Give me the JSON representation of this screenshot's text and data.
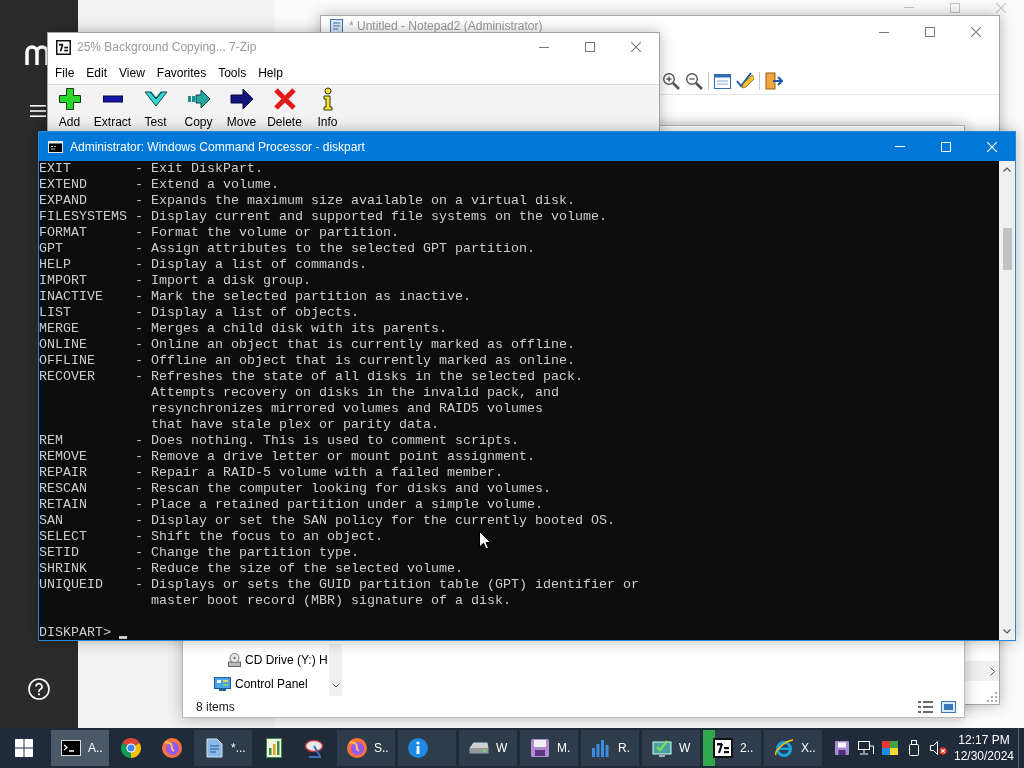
{
  "notepad_window": {
    "title": "* Untitled - Notepad2 (Administrator)"
  },
  "explorer_window": {
    "tree": [
      {
        "children": [
          {
            "label": "CD Drive (Y:) H",
            "kind": "cd-drive"
          }
        ]
      },
      {
        "label": "Control Panel",
        "kind": "control-panel"
      }
    ],
    "status_bar": "8 items"
  },
  "zip_window": {
    "title": "25% Background Copying... 7-Zip",
    "menu": [
      "File",
      "Edit",
      "View",
      "Favorites",
      "Tools",
      "Help"
    ],
    "toolbar": [
      {
        "label": "Add",
        "kind": "add"
      },
      {
        "label": "Extract",
        "kind": "extract"
      },
      {
        "label": "Test",
        "kind": "test"
      },
      {
        "label": "Copy",
        "kind": "copy"
      },
      {
        "label": "Move",
        "kind": "move"
      },
      {
        "label": "Delete",
        "kind": "delete"
      },
      {
        "label": "Info",
        "kind": "info"
      }
    ]
  },
  "console_window": {
    "title": "Administrator: Windows Command Processor - diskpart",
    "entries": [
      {
        "command": "EXIT",
        "lines": [
          "- Exit DiskPart."
        ]
      },
      {
        "command": "EXTEND",
        "lines": [
          "- Extend a volume."
        ]
      },
      {
        "command": "EXPAND",
        "lines": [
          "- Expands the maximum size available on a virtual disk."
        ]
      },
      {
        "command": "FILESYSTEMS",
        "lines": [
          "- Display current and supported file systems on the volume."
        ]
      },
      {
        "command": "FORMAT",
        "lines": [
          "- Format the volume or partition."
        ]
      },
      {
        "command": "GPT",
        "lines": [
          "- Assign attributes to the selected GPT partition."
        ]
      },
      {
        "command": "HELP",
        "lines": [
          "- Display a list of commands."
        ]
      },
      {
        "command": "IMPORT",
        "lines": [
          "- Import a disk group."
        ]
      },
      {
        "command": "INACTIVE",
        "lines": [
          "- Mark the selected partition as inactive."
        ]
      },
      {
        "command": "LIST",
        "lines": [
          "- Display a list of objects."
        ]
      },
      {
        "command": "MERGE",
        "lines": [
          "- Merges a child disk with its parents."
        ]
      },
      {
        "command": "ONLINE",
        "lines": [
          "- Online an object that is currently marked as offline."
        ]
      },
      {
        "command": "OFFLINE",
        "lines": [
          "- Offline an object that is currently marked as online."
        ]
      },
      {
        "command": "RECOVER",
        "lines": [
          "- Refreshes the state of all disks in the selected pack.",
          "Attempts recovery on disks in the invalid pack, and",
          "resynchronizes mirrored volumes and RAID5 volumes",
          "that have stale plex or parity data."
        ]
      },
      {
        "command": "REM",
        "lines": [
          "- Does nothing. This is used to comment scripts."
        ]
      },
      {
        "command": "REMOVE",
        "lines": [
          "- Remove a drive letter or mount point assignment."
        ]
      },
      {
        "command": "REPAIR",
        "lines": [
          "- Repair a RAID-5 volume with a failed member."
        ]
      },
      {
        "command": "RESCAN",
        "lines": [
          "- Rescan the computer looking for disks and volumes."
        ]
      },
      {
        "command": "RETAIN",
        "lines": [
          "- Place a retained partition under a simple volume."
        ]
      },
      {
        "command": "SAN",
        "lines": [
          "- Display or set the SAN policy for the currently booted OS."
        ]
      },
      {
        "command": "SELECT",
        "lines": [
          "- Shift the focus to an object."
        ]
      },
      {
        "command": "SETID",
        "lines": [
          "- Change the partition type."
        ]
      },
      {
        "command": "SHRINK",
        "lines": [
          "- Reduce the size of the selected volume."
        ]
      },
      {
        "command": "UNIQUEID",
        "lines": [
          "- Displays or sets the GUID partition table (GPT) identifier or",
          "master boot record (MBR) signature of a disk."
        ]
      }
    ],
    "prompt": "DISKPART>"
  },
  "taskbar": {
    "items": [
      {
        "kind": "cmd",
        "label": "A..",
        "running": true,
        "selected": true
      },
      {
        "kind": "chrome",
        "running": false,
        "selected": false
      },
      {
        "kind": "firefox",
        "running": false,
        "selected": false
      },
      {
        "kind": "notepad",
        "label": "*...",
        "running": true,
        "selected": false
      },
      {
        "kind": "chart-doc",
        "running": false,
        "selected": false
      },
      {
        "kind": "dish",
        "running": false,
        "selected": false
      },
      {
        "kind": "firefox",
        "label": "S..",
        "running": true,
        "selected": false
      },
      {
        "kind": "info",
        "running": true,
        "selected": false
      },
      {
        "kind": "drive",
        "label": "W",
        "running": true,
        "selected": false
      },
      {
        "kind": "floppy",
        "label": "M.",
        "running": true,
        "selected": false
      },
      {
        "kind": "bars",
        "label": "R.",
        "running": true,
        "selected": false
      },
      {
        "kind": "monitor",
        "label": "W",
        "running": true,
        "selected": false
      },
      {
        "kind": "archive",
        "label": "2..",
        "running": true,
        "selected": false,
        "level": 0.2
      },
      {
        "kind": "ie",
        "label": "X..",
        "running": true,
        "selected": false
      }
    ],
    "clock": {
      "time": "12:17 PM",
      "date": "12/30/2024"
    }
  }
}
